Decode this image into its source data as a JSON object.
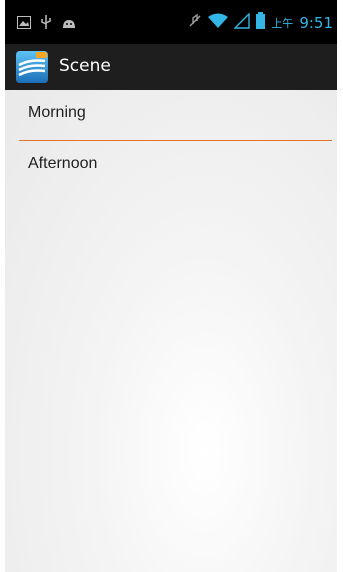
{
  "status_bar": {
    "left_icons": [
      "image-icon",
      "usb-icon",
      "android-icon"
    ],
    "right_icons": [
      "mute-icon",
      "wifi-icon",
      "signal-icon",
      "battery-icon"
    ],
    "time_prefix": "上午",
    "time": "9:51",
    "accent_color": "#33b5e5"
  },
  "action_bar": {
    "title": "Scene",
    "icon": "app-icon"
  },
  "list": {
    "items": [
      {
        "label": "Morning"
      },
      {
        "label": "Afternoon"
      }
    ],
    "divider_color": "#e0742e"
  }
}
